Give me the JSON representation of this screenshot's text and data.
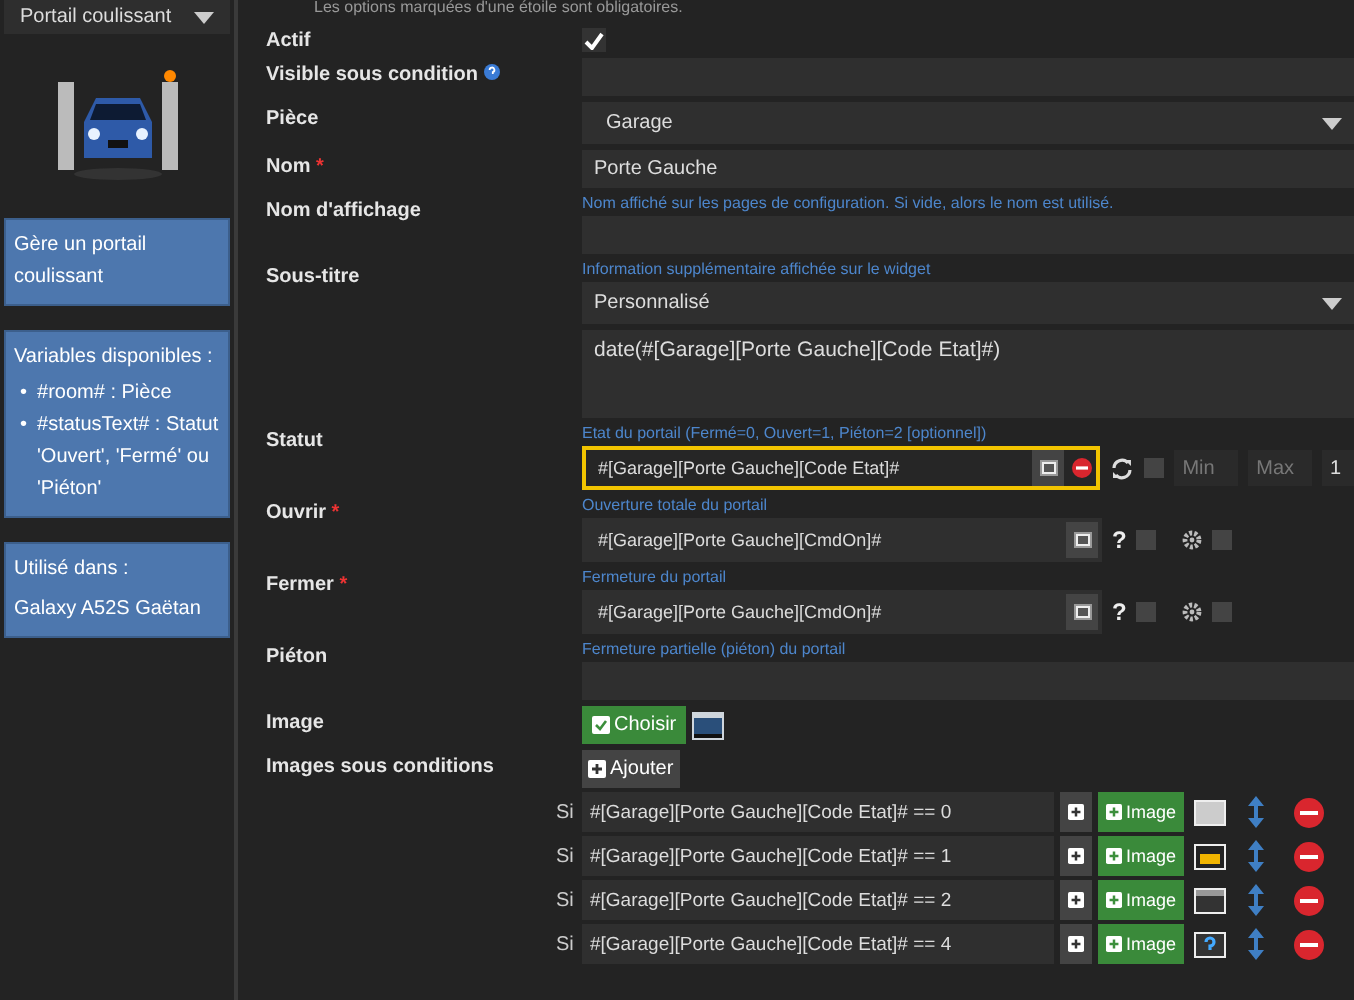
{
  "sidebar": {
    "type_select": "Portail coulissant",
    "description": "Gère un portail coulissant",
    "variables": {
      "title": "Variables disponibles :",
      "items": [
        {
          "bullet": "•",
          "text": "#room# : Pièce"
        },
        {
          "bullet": "•",
          "text": "#statusText# : Statut 'Ouvert', 'Fermé' ou 'Piéton'"
        }
      ]
    },
    "used_in": {
      "title": "Utilisé dans :",
      "items": [
        "Galaxy A52S Gaëtan"
      ]
    }
  },
  "notice": "Les options marquées d'une étoile sont obligatoires.",
  "fields": [
    {
      "kind": "checkbox",
      "label": "Actif",
      "checked": true
    },
    {
      "kind": "input",
      "label": "Visible sous condition",
      "help_icon": true
    },
    {
      "kind": "select",
      "label": "Pièce",
      "value": "Garage"
    },
    {
      "kind": "input",
      "label": "Nom",
      "required_mark": "*",
      "value": "Porte Gauche"
    },
    {
      "kind": "input",
      "label": "Nom d'affichage",
      "hint": "Nom affiché sur les pages de configuration. Si vide, alors le nom est utilisé."
    },
    {
      "kind": "select",
      "label": "Sous-titre",
      "hint": "Information supplémentaire affichée sur le widget",
      "value": "Personnalisé",
      "textarea": "date(#[Garage][Porte Gauche][Code Etat]#)"
    },
    {
      "kind": "info",
      "label": "Statut",
      "highlighted": true,
      "hint": "Etat du portail (Fermé=0, Ouvert=1, Piéton=2 [optionnel])",
      "value": "#[Garage][Porte Gauche][Code Etat]#",
      "auto_checked": false,
      "min_placeholder": "Min",
      "max_placeholder": "Max",
      "step": "1"
    },
    {
      "kind": "action",
      "label": "Ouvrir",
      "required_mark": "*",
      "highlighted": false,
      "hint": "Ouverture totale du portail",
      "value": "#[Garage][Porte Gauche][CmdOn]#",
      "confirm_mark": "?",
      "confirm_checked": false,
      "option_checked": false
    },
    {
      "kind": "action",
      "label": "Fermer",
      "required_mark": "*",
      "highlighted": false,
      "hint": "Fermeture du portail",
      "value": "#[Garage][Porte Gauche][CmdOn]#",
      "confirm_mark": "?",
      "confirm_checked": false,
      "option_checked": false
    },
    {
      "kind": "input",
      "label": "Piéton",
      "hint": "Fermeture partielle (piéton) du portail"
    },
    {
      "kind": "image",
      "label": "Image",
      "button": "Choisir"
    },
    {
      "kind": "conditions",
      "label": "Images sous conditions",
      "button": "Ajouter",
      "rows": [
        {
          "kind": "closed",
          "prefix": "Si",
          "expression": "#[Garage][Porte Gauche][Code Etat]# == 0",
          "image_button": "Image"
        },
        {
          "kind": "car",
          "prefix": "Si",
          "expression": "#[Garage][Porte Gauche][Code Etat]#  == 1",
          "image_button": "Image"
        },
        {
          "kind": "open",
          "prefix": "Si",
          "expression": "#[Garage][Porte Gauche][Code Etat]#  == 2",
          "image_button": "Image"
        },
        {
          "kind": "unknown",
          "prefix": "Si",
          "expression": "#[Garage][Porte Gauche][Code Etat]#  == 4",
          "image_button": "Image"
        }
      ]
    }
  ]
}
